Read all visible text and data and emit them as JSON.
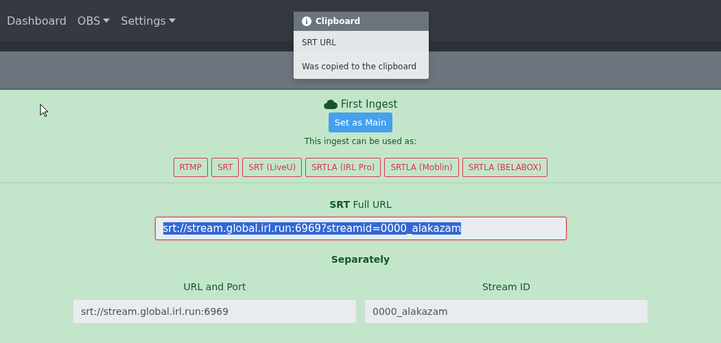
{
  "navbar": {
    "items": [
      {
        "label": "Dashboard",
        "dropdown": false
      },
      {
        "label": "OBS",
        "dropdown": true
      },
      {
        "label": "Settings",
        "dropdown": true
      }
    ]
  },
  "toast": {
    "title": "Clipboard",
    "lines": [
      "SRT URL",
      "Was copied to the clipboard"
    ]
  },
  "ingest": {
    "name": "First Ingest",
    "button": "Set as Main",
    "usage_label": "This ingest can be used as:",
    "protocols": [
      {
        "label": "RTMP",
        "selected": false
      },
      {
        "label": "SRT",
        "selected": false
      },
      {
        "label": "SRT (LiveU)",
        "selected": false
      },
      {
        "label": "SRTLA (IRL Pro)",
        "selected": false
      },
      {
        "label": "SRTLA (Moblin)",
        "selected": false
      },
      {
        "label": "SRTLA (BELABOX)",
        "selected": false
      }
    ]
  },
  "full_url": {
    "label": "**SRT** Full URL",
    "value": "srt://stream.global.irl.run:6969?streamid=0000_alakazam",
    "text_selected": true
  },
  "separately": {
    "title": "Separately",
    "fields": [
      {
        "label": "URL and Port",
        "value": "srt://stream.global.irl.run:6969"
      },
      {
        "label": "Stream ID",
        "value": "0000_alakazam"
      }
    ]
  }
}
